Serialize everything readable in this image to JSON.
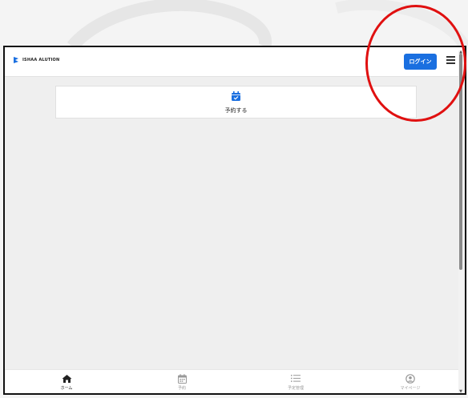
{
  "header": {
    "logo_text": "ISHAA ALUTION",
    "login_label": "ログイン",
    "menu_icon": "hamburger-menu-icon"
  },
  "main": {
    "reserve_label": "予約する",
    "reserve_icon": "calendar-check-icon"
  },
  "bottom_nav": {
    "items": [
      {
        "label": "ホーム",
        "icon": "home-icon",
        "active": true
      },
      {
        "label": "予約",
        "icon": "calendar-icon",
        "active": false
      },
      {
        "label": "予定管理",
        "icon": "list-icon",
        "active": false
      },
      {
        "label": "マイページ",
        "icon": "user-circle-icon",
        "active": false
      }
    ]
  },
  "colors": {
    "accent": "#1a6fe0",
    "highlight": "#e01010",
    "background": "#efefef"
  }
}
